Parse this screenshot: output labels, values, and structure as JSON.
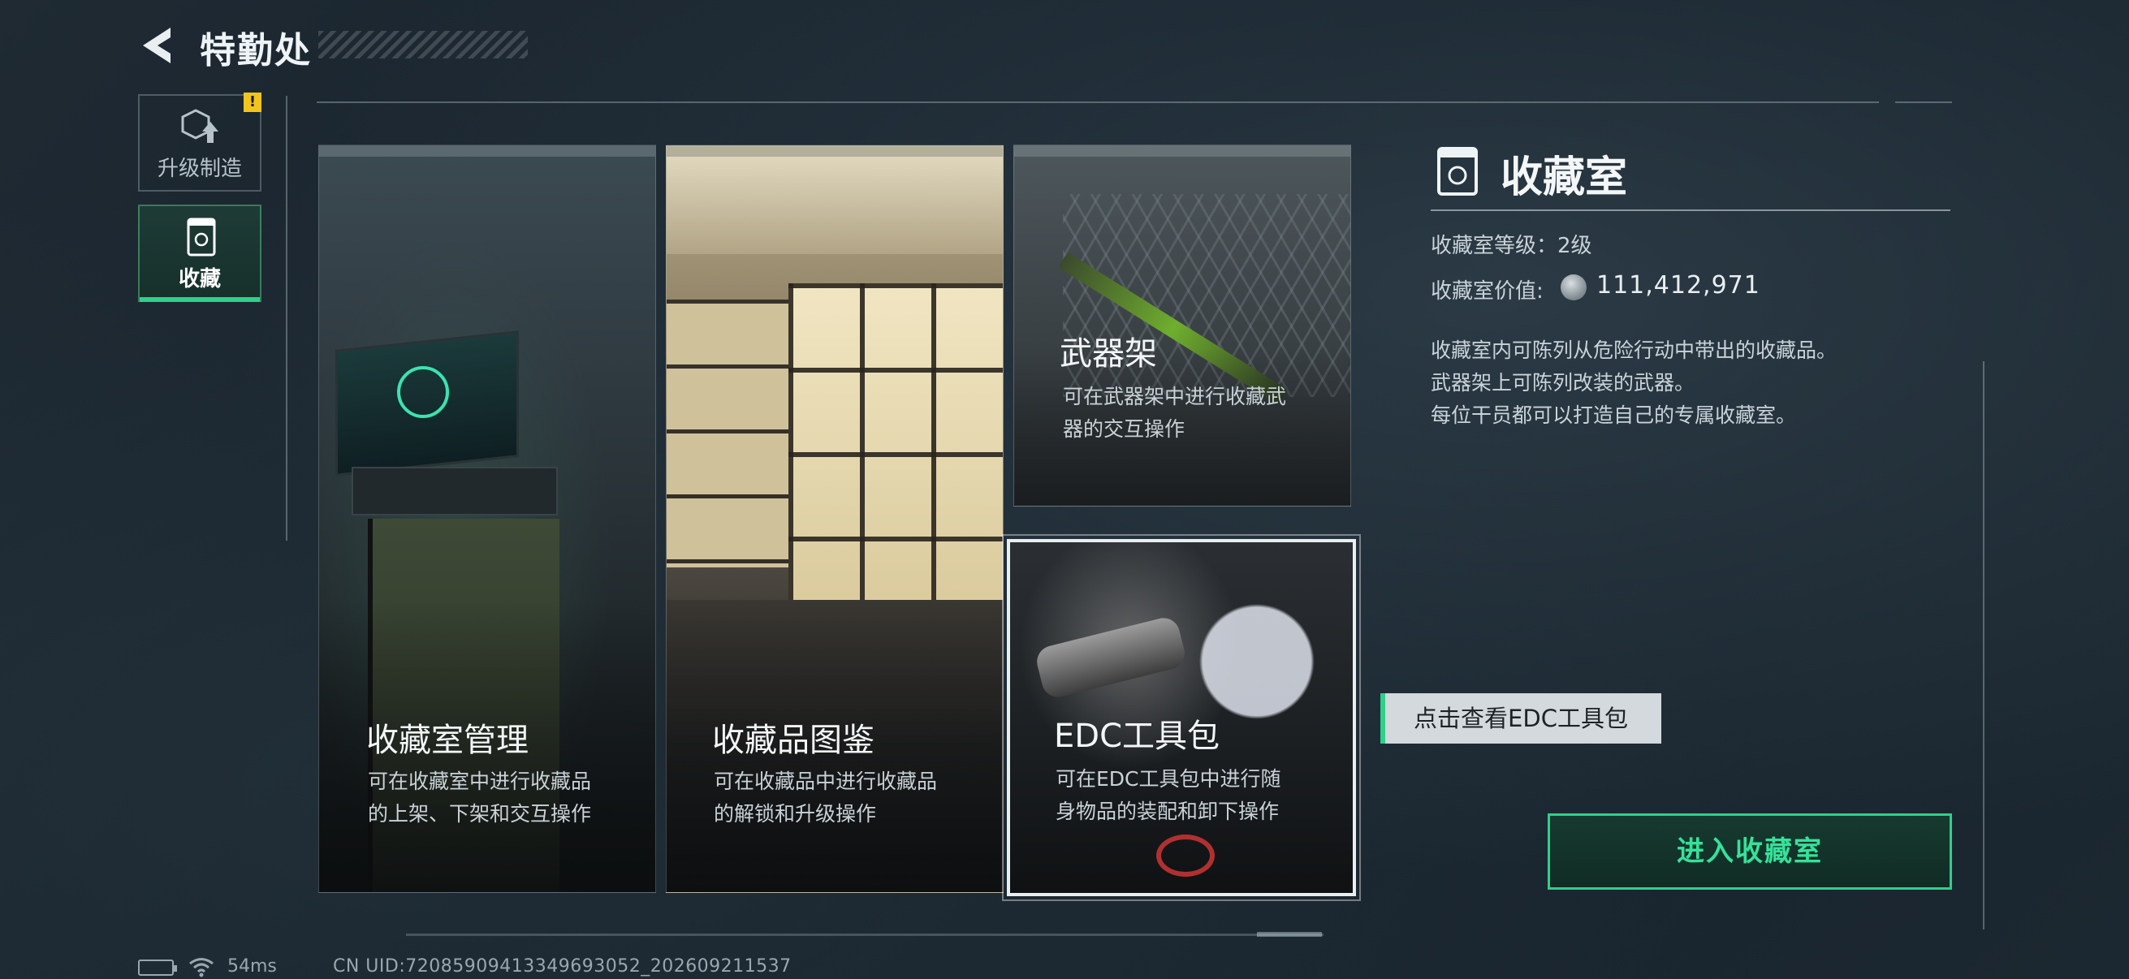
{
  "header": {
    "title": "特勤处"
  },
  "sidebar": {
    "items": [
      {
        "label": "升级制造",
        "alert": "!"
      },
      {
        "label": "收藏"
      }
    ]
  },
  "cards": {
    "manage": {
      "title": "收藏室管理",
      "desc1": "可在收藏室中进行收藏品",
      "desc2": "的上架、下架和交互操作"
    },
    "catalog": {
      "title": "收藏品图鉴",
      "desc1": "可在收藏品中进行收藏品",
      "desc2": "的解锁和升级操作"
    },
    "weapon": {
      "title": "武器架",
      "desc1": "可在武器架中进行收藏武",
      "desc2": "器的交互操作"
    },
    "edc": {
      "title": "EDC工具包",
      "desc1": "可在EDC工具包中进行随",
      "desc2": "身物品的装配和卸下操作"
    }
  },
  "info": {
    "title": "收藏室",
    "level": "收藏室等级：2级",
    "value_label": "收藏室价值:",
    "value": "111,412,971",
    "desc": [
      "收藏室内可陈列从危险行动中带出的收藏品。",
      "武器架上可陈列改装的武器。",
      "每位干员都可以打造自己的专属收藏室。"
    ]
  },
  "edc_hint": "点击查看EDC工具包",
  "enter_button": "进入收藏室",
  "status": {
    "ping": "54ms",
    "uid": "CN UID:72085909413349693052_202609211537"
  },
  "colors": {
    "accent": "#2fd08a",
    "alert": "#f2c41c"
  }
}
